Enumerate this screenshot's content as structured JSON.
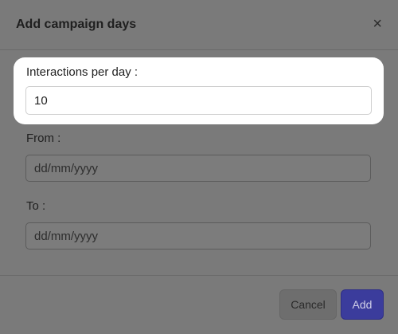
{
  "modal": {
    "title": "Add campaign days",
    "close_glyph": "×",
    "fields": [
      {
        "label": "Interactions per day :",
        "value": "10",
        "placeholder": ""
      },
      {
        "label": "From :",
        "value": "",
        "placeholder": "dd/mm/yyyy"
      },
      {
        "label": "To :",
        "value": "",
        "placeholder": "dd/mm/yyyy"
      }
    ],
    "buttons": {
      "cancel": "Cancel",
      "add": "Add"
    }
  },
  "colors": {
    "overlay": "#707070",
    "primary_button": "#3b3c9c",
    "highlight": "#ffffff"
  }
}
